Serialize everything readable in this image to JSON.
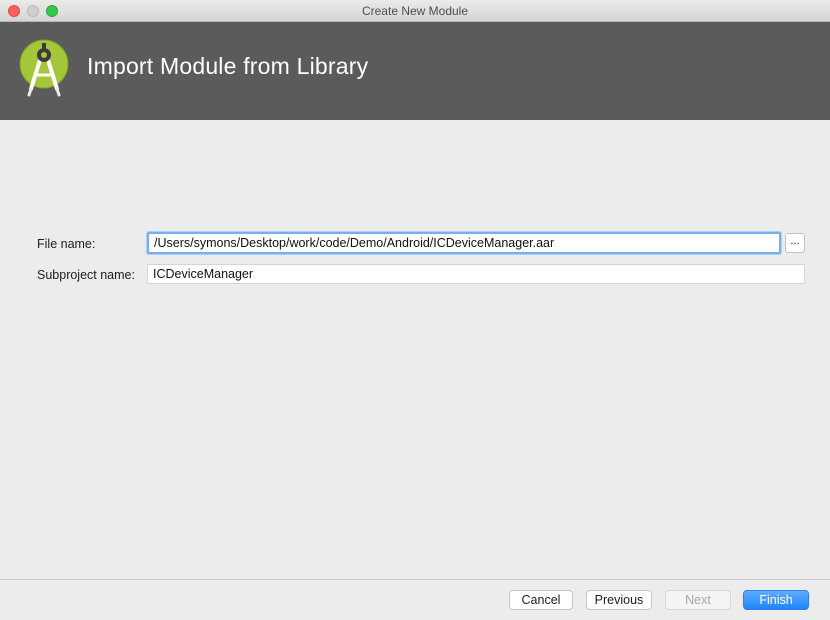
{
  "window": {
    "title": "Create New Module"
  },
  "header": {
    "title": "Import Module from Library",
    "logo_icon": "android-studio-logo-icon",
    "background_color": "#5b5b5b"
  },
  "form": {
    "file_name_label": "File name:",
    "file_name_value": "/Users/symons/Desktop/work/code/Demo/Android/ICDeviceManager.aar",
    "browse_label": "...",
    "subproject_label": "Subproject name:",
    "subproject_value": "ICDeviceManager"
  },
  "footer": {
    "cancel_label": "Cancel",
    "previous_label": "Previous",
    "next_label": "Next",
    "finish_label": "Finish",
    "accent_color": "#1f85f7"
  }
}
